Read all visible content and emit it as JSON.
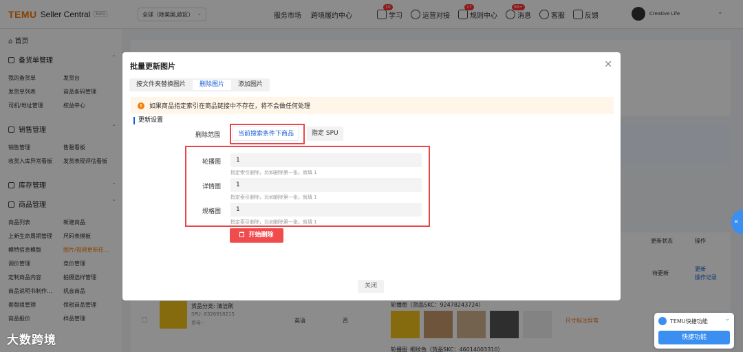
{
  "app": {
    "brand": "TEMU",
    "product": "Seller Central",
    "beta": "Beta"
  },
  "header": {
    "region": "全球（除美国,欧区）",
    "nav": [
      "服务市场",
      "跨境履约中心"
    ],
    "tools": [
      {
        "label": "学习",
        "badge": "10",
        "icon": "book-icon"
      },
      {
        "label": "运营对接",
        "badge": "",
        "icon": "chat-icon"
      },
      {
        "label": "规则中心",
        "badge": "17",
        "icon": "rules-icon"
      },
      {
        "label": "消息",
        "badge": "99+",
        "icon": "bell-icon"
      },
      {
        "label": "客服",
        "badge": "",
        "icon": "headset-icon"
      },
      {
        "label": "反馈",
        "badge": "",
        "icon": "feedback-icon"
      }
    ],
    "user": "Creative Life"
  },
  "sidebar": {
    "home": "首页",
    "sections": [
      {
        "title": "备货单管理",
        "items": [
          "我的备货单",
          "发货台",
          "发货单列表",
          "商品条码管理",
          "司机/地址管理",
          "权益中心"
        ]
      },
      {
        "title": "销售管理",
        "items": [
          "销售管理",
          "售罄看板",
          "收货入库异常看板",
          "发货表现评估看板"
        ]
      },
      {
        "title": "库存管理",
        "items": []
      },
      {
        "title": "商品管理",
        "items": [
          "商品列表",
          "新建商品",
          "上新生命周期管理",
          "尺码表模板",
          "模特信息模版",
          "图片/视频更新任...",
          "调价管理",
          "竞价管理",
          "定制商品内容",
          "拍摄选样管理",
          "商品说明书制作...",
          "机会商品",
          "套版组管理",
          "保税商品管理",
          "商品报价",
          "样品管理"
        ]
      }
    ]
  },
  "background": {
    "col_status": "更新状态",
    "col_action": "操作",
    "status_pending": "待更新",
    "action_update": "更新",
    "action_log": "操作记录",
    "product_category": "货品分类: 清洁刷",
    "spu": "SPU: 8326918215",
    "sku_id": "货号:-",
    "language": "英语",
    "no": "否",
    "carousel_sku": "轮播图（货品SKC：92478243724）",
    "size_abnormal": "尺寸标注异常",
    "carousel_sku2": "轮播图_细纹色（货品SKC：46014003310）"
  },
  "modal": {
    "title": "批量更新图片",
    "tabs": [
      "按文件夹替换图片",
      "删除图片",
      "添加图片"
    ],
    "active_tab": 1,
    "notice": "如果商品指定索引在商品链接中不存在，将不会做任何处理",
    "section": "更新设置",
    "scope_label": "删除范围",
    "scope_current": "当前搜索条件下商品",
    "scope_spu": "指定 SPU",
    "fields": [
      {
        "label": "轮播图",
        "value": "1",
        "hint": "指定索引删除，比如删除第一张，就填 1"
      },
      {
        "label": "详情图",
        "value": "1",
        "hint": "指定索引删除，比如删除第一张，就填 1"
      },
      {
        "label": "规格图",
        "value": "1",
        "hint": "指定索引删除，比如删除第一张，就填 1"
      }
    ],
    "start_button": "开始删除",
    "close_button": "关闭"
  },
  "quick_widget": {
    "title": "TEMU快捷功能",
    "button": "快捷功能"
  },
  "watermark": "大数跨境",
  "colors": {
    "brand_orange": "#fb7701",
    "accent_blue": "#1a5fd6",
    "danger_red": "#f04b4d",
    "highlight_red": "#e8474a"
  }
}
